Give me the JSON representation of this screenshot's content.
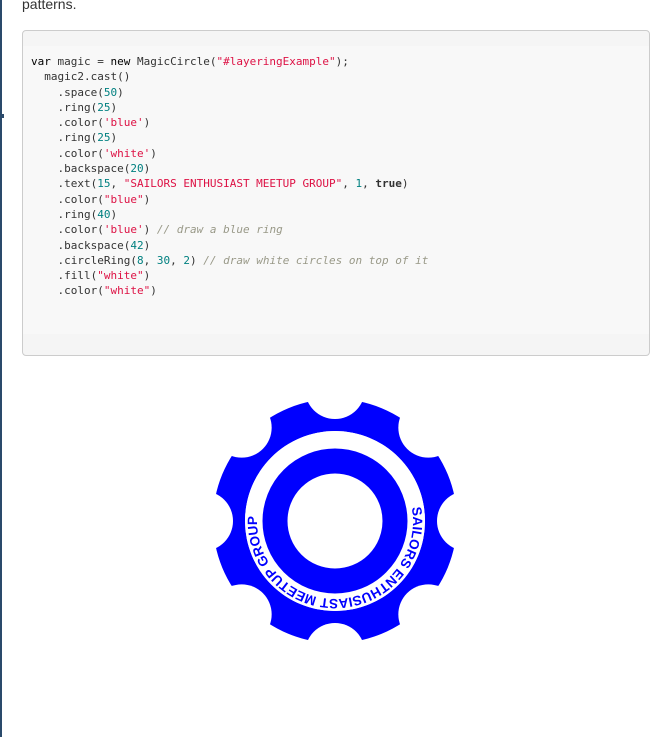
{
  "intro_text": "patterns.",
  "code": {
    "lines": [
      [
        {
          "t": "var",
          "c": "kw"
        },
        {
          "t": " magic = "
        },
        {
          "t": "new",
          "c": "kw"
        },
        {
          "t": " MagicCircle("
        },
        {
          "t": "\"#layeringExample\"",
          "c": "str"
        },
        {
          "t": ");"
        }
      ],
      [
        {
          "t": "  magic2.cast()"
        }
      ],
      [
        {
          "t": "    .space("
        },
        {
          "t": "50",
          "c": "num"
        },
        {
          "t": ")"
        }
      ],
      [
        {
          "t": "    .ring("
        },
        {
          "t": "25",
          "c": "num"
        },
        {
          "t": ")"
        }
      ],
      [
        {
          "t": "    .color("
        },
        {
          "t": "'blue'",
          "c": "str"
        },
        {
          "t": ")"
        }
      ],
      [
        {
          "t": "    .ring("
        },
        {
          "t": "25",
          "c": "num"
        },
        {
          "t": ")"
        }
      ],
      [
        {
          "t": "    .color("
        },
        {
          "t": "'white'",
          "c": "str"
        },
        {
          "t": ")"
        }
      ],
      [
        {
          "t": "    .backspace("
        },
        {
          "t": "20",
          "c": "num"
        },
        {
          "t": ")"
        }
      ],
      [
        {
          "t": "    .text("
        },
        {
          "t": "15",
          "c": "num"
        },
        {
          "t": ", "
        },
        {
          "t": "\"SAILORS ENTHUSIAST MEETUP GROUP\"",
          "c": "str"
        },
        {
          "t": ", "
        },
        {
          "t": "1",
          "c": "num"
        },
        {
          "t": ", "
        },
        {
          "t": "true",
          "c": "bool"
        },
        {
          "t": ")"
        }
      ],
      [
        {
          "t": "    .color("
        },
        {
          "t": "\"blue\"",
          "c": "str"
        },
        {
          "t": ")"
        }
      ],
      [
        {
          "t": "    .ring("
        },
        {
          "t": "40",
          "c": "num"
        },
        {
          "t": ")"
        }
      ],
      [
        {
          "t": "    .color("
        },
        {
          "t": "'blue'",
          "c": "str"
        },
        {
          "t": ") "
        },
        {
          "t": "// draw a blue ring",
          "c": "cmt"
        }
      ],
      [
        {
          "t": "    .backspace("
        },
        {
          "t": "42",
          "c": "num"
        },
        {
          "t": ")"
        }
      ],
      [
        {
          "t": "    .circleRing("
        },
        {
          "t": "8",
          "c": "num"
        },
        {
          "t": ", "
        },
        {
          "t": "30",
          "c": "num"
        },
        {
          "t": ", "
        },
        {
          "t": "2",
          "c": "num"
        },
        {
          "t": ") "
        },
        {
          "t": "// draw white circles on top of it",
          "c": "cmt"
        }
      ],
      [
        {
          "t": "    .fill("
        },
        {
          "t": "\"white\"",
          "c": "str"
        },
        {
          "t": ")"
        }
      ],
      [
        {
          "t": "    .color("
        },
        {
          "t": "\"white\"",
          "c": "str"
        },
        {
          "t": ")"
        }
      ]
    ]
  },
  "figure": {
    "ring_text": "SAILORS ENTHUSIAST MEETUP GROUP",
    "colors": {
      "blue": "#0000ff",
      "white": "#ffffff"
    }
  }
}
